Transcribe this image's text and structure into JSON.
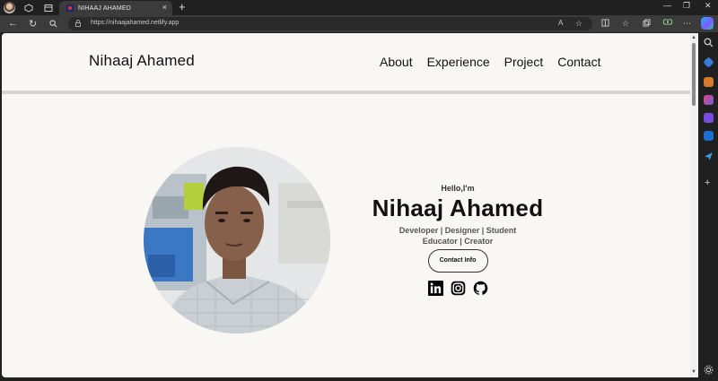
{
  "browser": {
    "tab_title": "NIHAAJ AHAMED",
    "url": "https://nihaajahamed.netlify.app",
    "url_display": "https://nihaajahamed.netlify.app",
    "read_aloud_icon": "A",
    "new_tab_icon": "+",
    "close_tab_icon": "×"
  },
  "site": {
    "brand": "Nihaaj Ahamed",
    "nav": [
      "About",
      "Experience",
      "Project",
      "Contact"
    ]
  },
  "hero": {
    "greeting": "Hello,I'm",
    "name": "Nihaaj Ahamed",
    "roles_line1": "Developer | Designer | Student",
    "roles_line2": "Educator | Creator",
    "contact_button": "Contact Info"
  },
  "socials": [
    "linkedin-icon",
    "instagram-icon",
    "github-icon"
  ]
}
